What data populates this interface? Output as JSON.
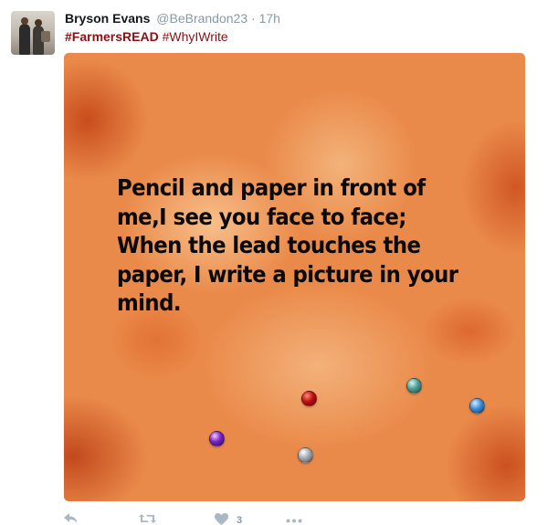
{
  "tweet": {
    "author_name": "Bryson Evans",
    "author_handle": "@BeBrandon23",
    "separator": "·",
    "time": "17h",
    "hashtags": [
      "#FarmersREAD",
      "#WhyIWrite"
    ],
    "image_text": "Pencil and paper in front of me,I see you face to face; When the lead touches the paper, I write a picture in your mind.",
    "image_lines": [
      "Pencil and paper in front of",
      "me,I see you face to face;",
      "When the lead touches the",
      "paper, I write a picture in your",
      "mind."
    ]
  },
  "actions": {
    "reply_icon": "reply-icon",
    "retweet_icon": "retweet-icon",
    "like_icon": "heart-icon",
    "like_count": "3",
    "more_icon": "more-dots-icon"
  },
  "colors": {
    "hashtag": "#8a1014",
    "muted": "#8899a6",
    "icon": "#aab8c2",
    "media_base": "#ea8a4a"
  }
}
